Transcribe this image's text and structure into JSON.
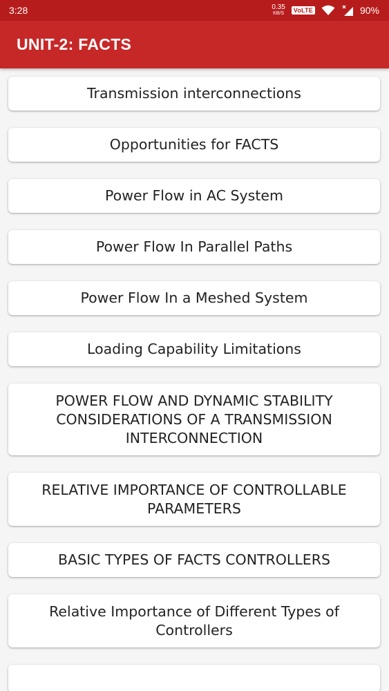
{
  "status_bar": {
    "time": "3:28",
    "net_speed_value": "0.35",
    "net_speed_unit": "KB/S",
    "volte_label": "VoLTE",
    "battery": "90%"
  },
  "app_bar": {
    "title": "UNIT-2: FACTS"
  },
  "topics": [
    "Transmission interconnections",
    "Opportunities for FACTS",
    "Power Flow in AC System",
    "Power Flow In Parallel Paths",
    "Power Flow In a Meshed System",
    "Loading Capability Limitations",
    "POWER FLOW AND DYNAMIC STABILITY CONSIDERATIONS OF A TRANSMISSION INTERCONNECTION",
    "RELATIVE IMPORTANCE OF CONTROLLABLE PARAMETERS",
    "BASIC TYPES OF FACTS CONTROLLERS",
    "Relative Importance of Different Types of Controllers"
  ],
  "colors": {
    "status_bar": "#b71c1c",
    "app_bar": "#c62828",
    "background": "#f5f5f5",
    "card": "#ffffff"
  }
}
